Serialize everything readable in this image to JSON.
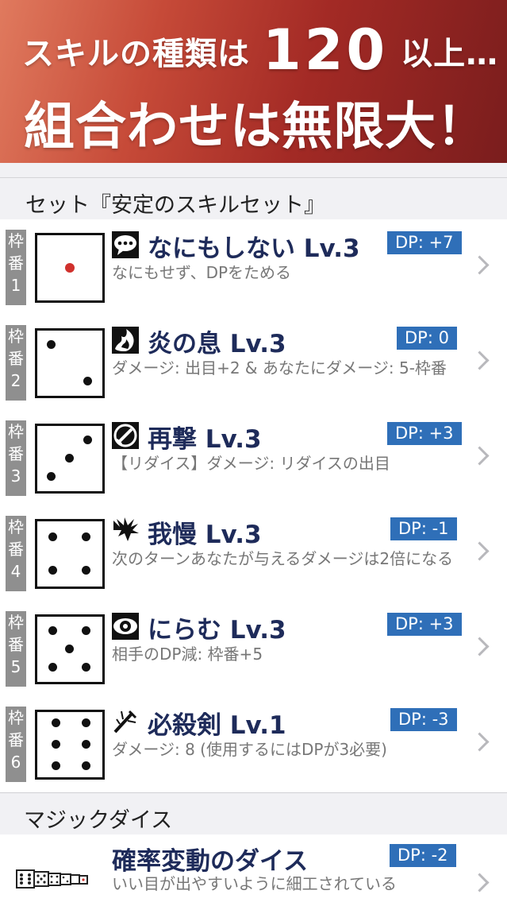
{
  "banner": {
    "line1_text": "スキルの種類は",
    "line1_number": "120",
    "line1_suffix": "以上…",
    "line2": "組合わせは無限大！"
  },
  "set_section": {
    "title": "セット『安定のスキルセット』"
  },
  "slots": [
    {
      "tab": [
        "枠",
        "番",
        "1"
      ],
      "name": "なにもしない Lv.3",
      "dp": "DP: +7",
      "desc": "なにもせず、DPをためる",
      "icon": "speech-bubble-icon",
      "pips": 1
    },
    {
      "tab": [
        "枠",
        "番",
        "2"
      ],
      "name": "炎の息 Lv.3",
      "dp": "DP: 0",
      "desc": "ダメージ: 出目+2 & あなたにダメージ: 5-枠番",
      "icon": "fire-breath-icon",
      "pips": 2
    },
    {
      "tab": [
        "枠",
        "番",
        "3"
      ],
      "name": "再撃 Lv.3",
      "dp": "DP: +3",
      "desc": "【リダイス】ダメージ: リダイスの出目",
      "icon": "sword-strike-icon",
      "pips": 3
    },
    {
      "tab": [
        "枠",
        "番",
        "4"
      ],
      "name": "我慢 Lv.3",
      "dp": "DP: -1",
      "desc": "次のターンあなたが与えるダメージは2倍になる",
      "icon": "endure-icon",
      "pips": 4
    },
    {
      "tab": [
        "枠",
        "番",
        "5"
      ],
      "name": "にらむ Lv.3",
      "dp": "DP: +3",
      "desc": "相手のDP減: 枠番+5",
      "icon": "glare-eye-icon",
      "pips": 5
    },
    {
      "tab": [
        "枠",
        "番",
        "6"
      ],
      "name": "必殺剣 Lv.1",
      "dp": "DP: -3",
      "desc": "ダメージ: 8 (使用するにはDPが3必要)",
      "icon": "deadly-sword-icon",
      "pips": 6
    }
  ],
  "magic_section": {
    "title": "マジックダイス"
  },
  "magic_dice": {
    "name": "確率変動のダイス",
    "dp": "DP: -2",
    "desc": "いい目が出やすいように細工されている",
    "icon": "dice-strip-icon"
  },
  "colors": {
    "banner_start": "#e07a5e",
    "banner_end": "#7a1d1d",
    "dp_badge": "#2f6fb8",
    "skill_name": "#1e2b5a",
    "slot_tab": "#8f8f8f"
  }
}
